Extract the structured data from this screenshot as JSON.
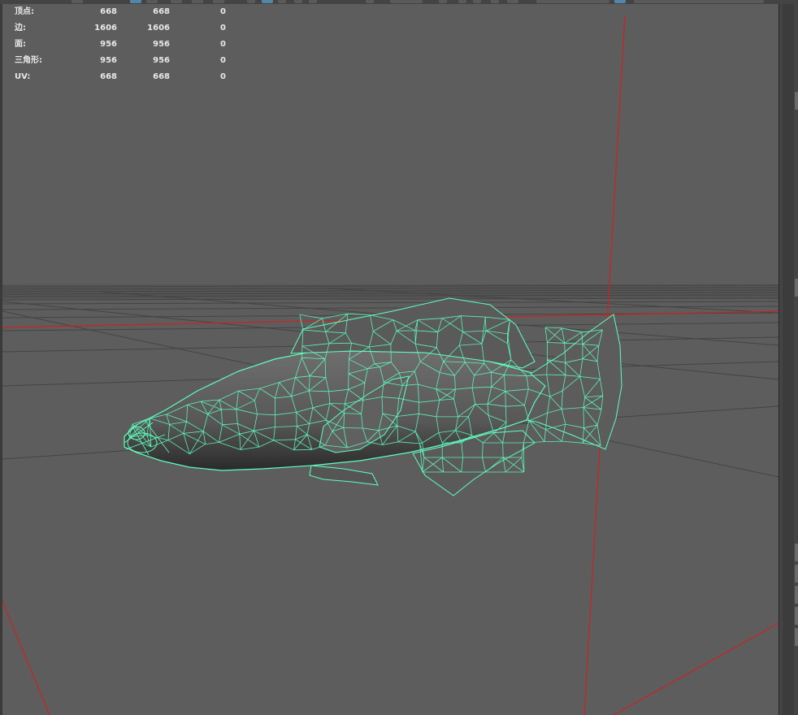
{
  "hud": {
    "rows": [
      {
        "label": "顶点:",
        "c1": "668",
        "c2": "668",
        "c3": "0"
      },
      {
        "label": "边:",
        "c1": "1606",
        "c2": "1606",
        "c3": "0"
      },
      {
        "label": "面:",
        "c1": "956",
        "c2": "956",
        "c3": "0"
      },
      {
        "label": "三角形:",
        "c1": "956",
        "c2": "956",
        "c3": "0"
      },
      {
        "label": "UV:",
        "c1": "668",
        "c2": "668",
        "c3": "0"
      }
    ]
  },
  "colors": {
    "viewport_bg": "#5d5d5d",
    "wireframe": "#5fffbf",
    "axis": "#cc2222",
    "grid": "#444444"
  }
}
